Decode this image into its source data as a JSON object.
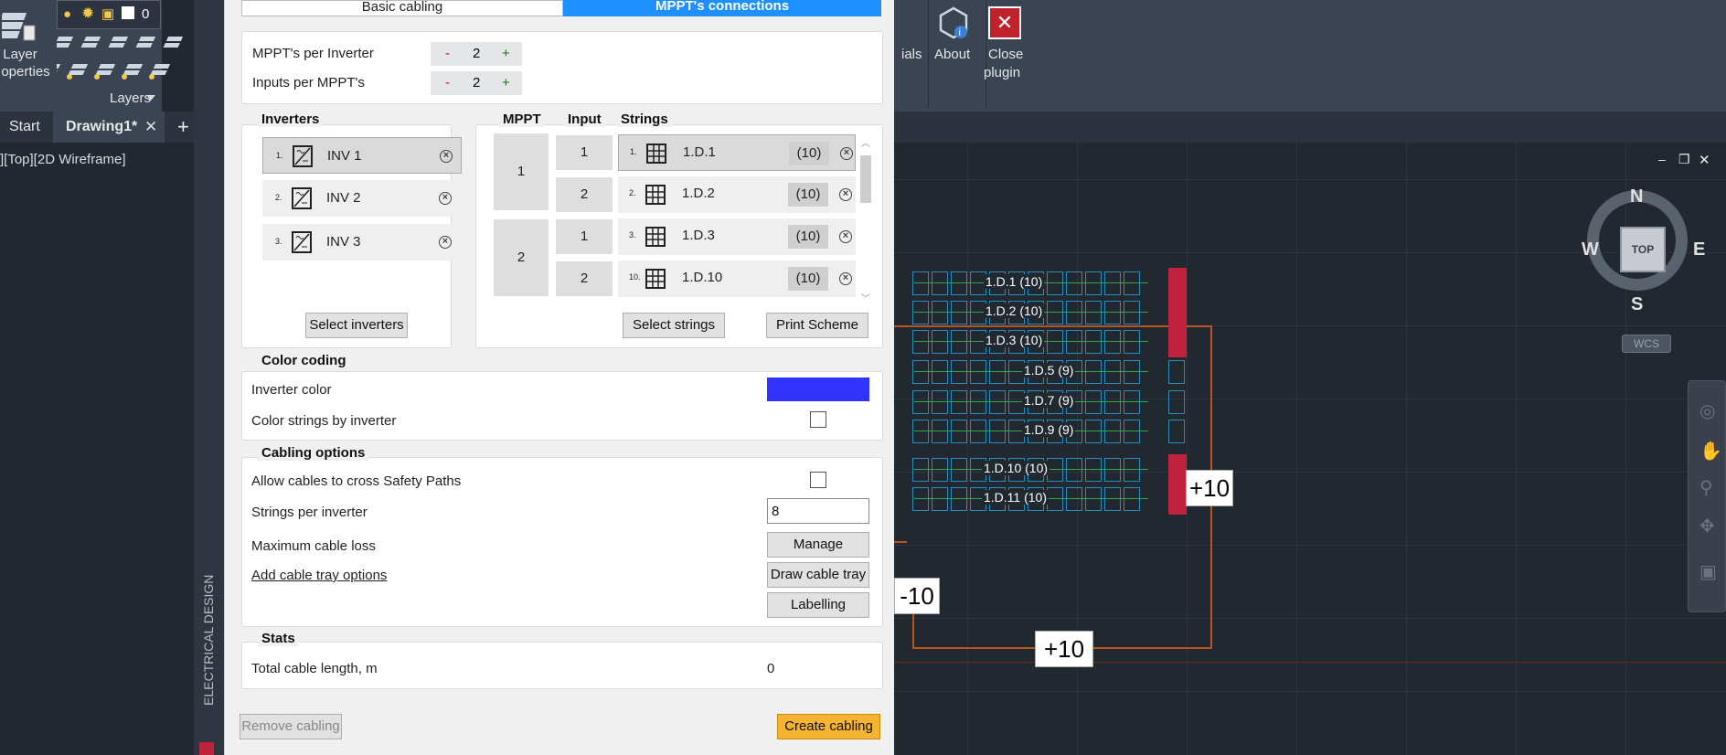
{
  "app": {
    "ribbon_left": {
      "layer_properties_label_1": "Layer",
      "layer_properties_label_2": "operties",
      "layer_number": "0",
      "layers_label": "Layers"
    },
    "tabs": [
      {
        "label": "Start"
      },
      {
        "label": "Drawing1*"
      }
    ],
    "viewport_label": "][Top][2D Wireframe]",
    "side_label": "ELECTRICAL DESIGN",
    "ribbon_right": {
      "partial_label": "ials",
      "about_label": "About",
      "close_label_1": "Close",
      "close_label_2": "plugin"
    }
  },
  "panel": {
    "tabs": {
      "basic": "Basic cabling",
      "mppt": "MPPT's connections"
    },
    "mppt_per_inverter": {
      "label": "MPPT's per Inverter",
      "value": "2",
      "minus": "-",
      "plus": "+"
    },
    "inputs_per_mppt": {
      "label": "Inputs per MPPT's",
      "value": "2",
      "minus": "-",
      "plus": "+"
    },
    "inverters": {
      "header": "Inverters",
      "items": [
        {
          "index": "1.",
          "name": "INV 1"
        },
        {
          "index": "2.",
          "name": "INV 2"
        },
        {
          "index": "3.",
          "name": "INV 3"
        }
      ],
      "select_button": "Select inverters"
    },
    "mppt_table": {
      "headers": {
        "mppt": "MPPT",
        "input": "Input",
        "strings": "Strings"
      },
      "mppts": [
        "1",
        "2"
      ],
      "inputs": [
        "1",
        "2",
        "1",
        "2"
      ],
      "strings": [
        {
          "index": "1.",
          "name": "1.D.1",
          "count": "(10)"
        },
        {
          "index": "2.",
          "name": "1.D.2",
          "count": "(10)"
        },
        {
          "index": "3.",
          "name": "1.D.3",
          "count": "(10)"
        },
        {
          "index": "10.",
          "name": "1.D.10",
          "count": "(10)"
        }
      ],
      "select_button": "Select strings",
      "print_button": "Print Scheme"
    },
    "color_coding": {
      "header": "Color coding",
      "inverter_color_label": "Inverter color",
      "inverter_color": "#3333ff",
      "color_strings_label": "Color strings by inverter"
    },
    "cabling_options": {
      "header": "Cabling options",
      "allow_cross_label": "Allow cables to cross Safety Paths",
      "strings_per_inverter_label": "Strings per inverter",
      "strings_per_inverter_value": "8",
      "max_cable_loss_label": "Maximum cable loss",
      "manage_button": "Manage",
      "add_tray_link": "Add cable tray options",
      "draw_tray_button": "Draw cable tray",
      "labelling_button": "Labelling"
    },
    "stats": {
      "header": "Stats",
      "total_length_label": "Total cable length, m",
      "total_length_value": "0"
    },
    "remove_button": "Remove cabling",
    "create_button": "Create cabling"
  },
  "drawing": {
    "rows": [
      {
        "label": "1.D.1  (10)"
      },
      {
        "label": "1.D.2  (10)"
      },
      {
        "label": "1.D.3  (10)"
      },
      {
        "label": "1.D.5  (9)"
      },
      {
        "label": "1.D.7  (9)"
      },
      {
        "label": "1.D.9  (9)"
      },
      {
        "label": "1.D.10  (10)"
      },
      {
        "label": "1.D.11  (10)"
      }
    ],
    "plus_labels": [
      "+10",
      "+10"
    ],
    "minus_label": "-10",
    "compass": {
      "n": "N",
      "s": "S",
      "e": "E",
      "w": "W",
      "top": "TOP",
      "wcs": "WCS"
    }
  }
}
